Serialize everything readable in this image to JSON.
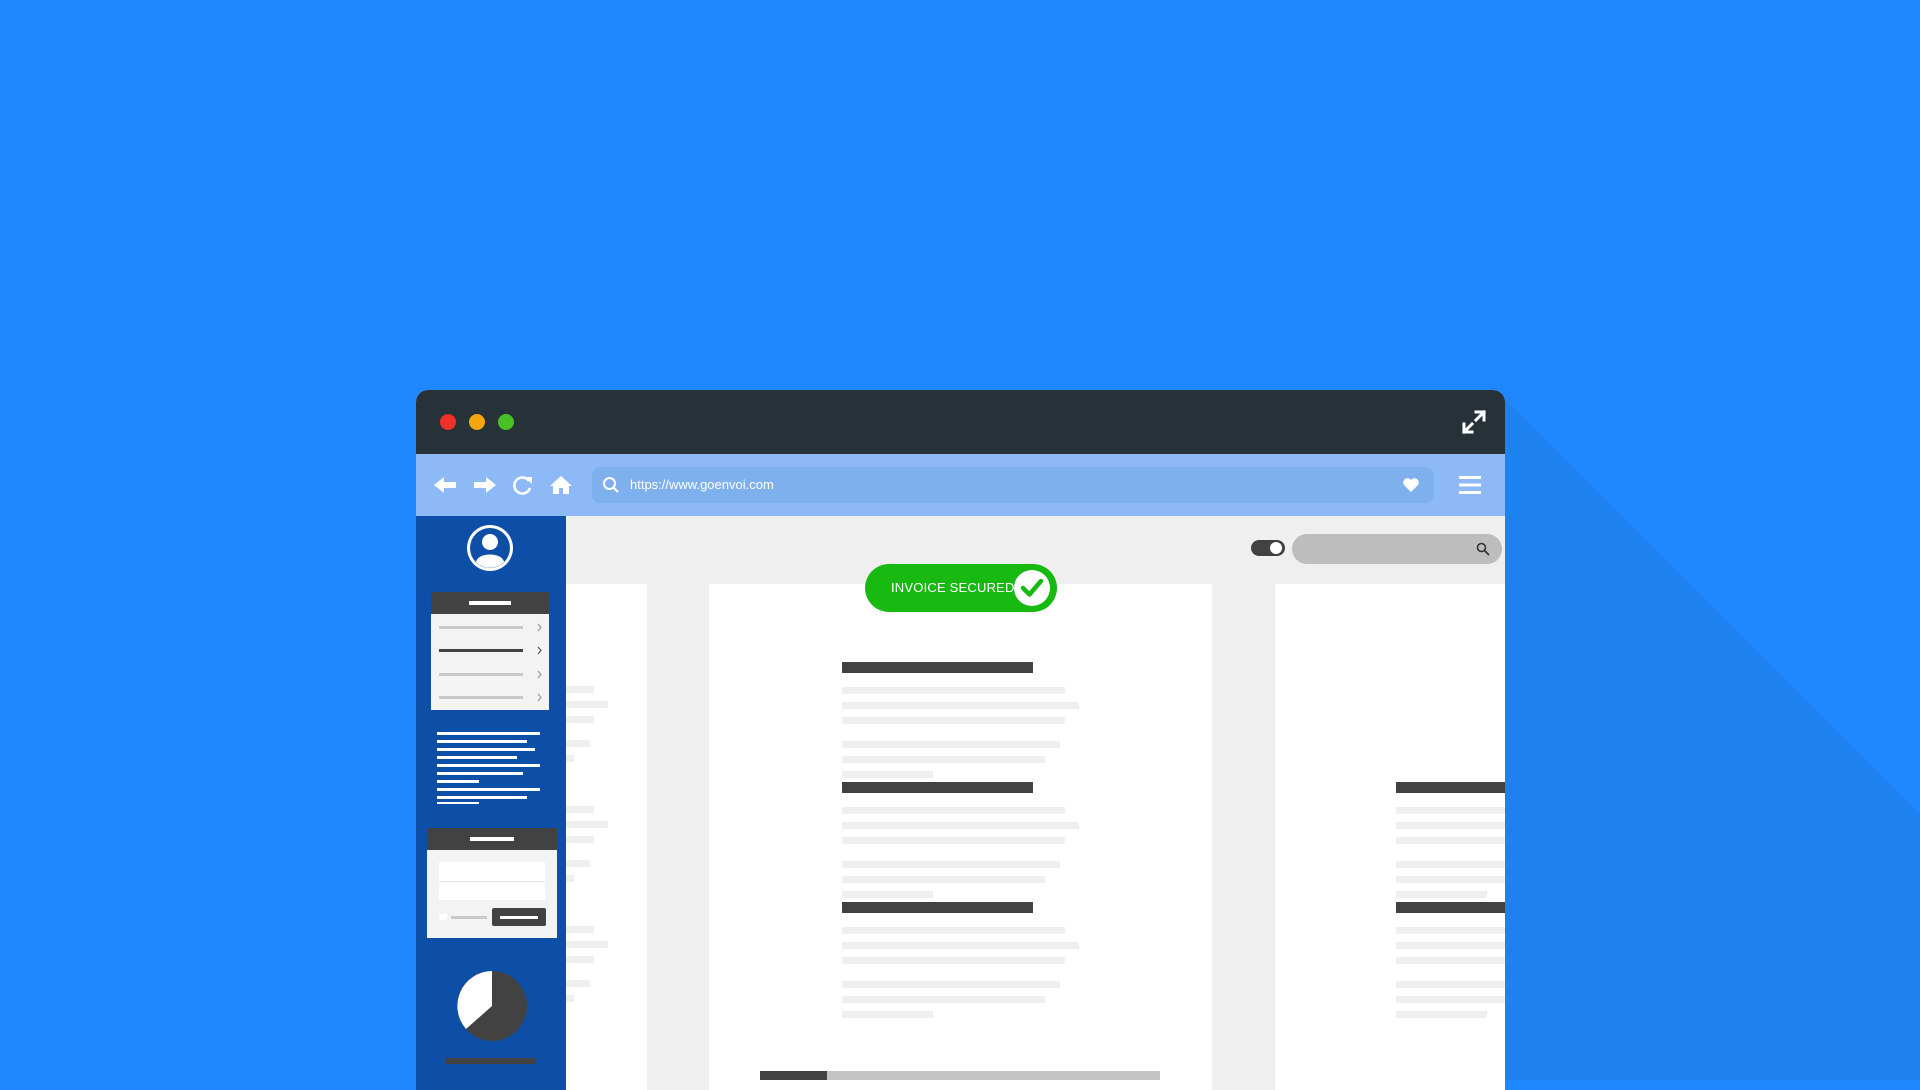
{
  "browser": {
    "url": "https://www.goenvoi.com"
  },
  "badge": {
    "label": "INVOICE SECURED"
  },
  "icons": {
    "window_controls": [
      "close-dot",
      "minimize-dot",
      "maximize-dot"
    ],
    "toolbar": [
      "back-arrow-icon",
      "forward-arrow-icon",
      "reload-icon",
      "home-icon",
      "search-icon",
      "heart-icon",
      "hamburger-menu-icon"
    ],
    "expand": "expand-icon",
    "sidebar": [
      "user-avatar-icon",
      "list-panel-icon",
      "text-lines-icon",
      "form-panel-icon",
      "pie-chart-icon"
    ]
  },
  "colors": {
    "background": "#1f87fd",
    "titlebar": "#263238",
    "toolbar": "#8dbaf6",
    "sidebar": "#0d4fa7",
    "badge": "#18b911"
  }
}
